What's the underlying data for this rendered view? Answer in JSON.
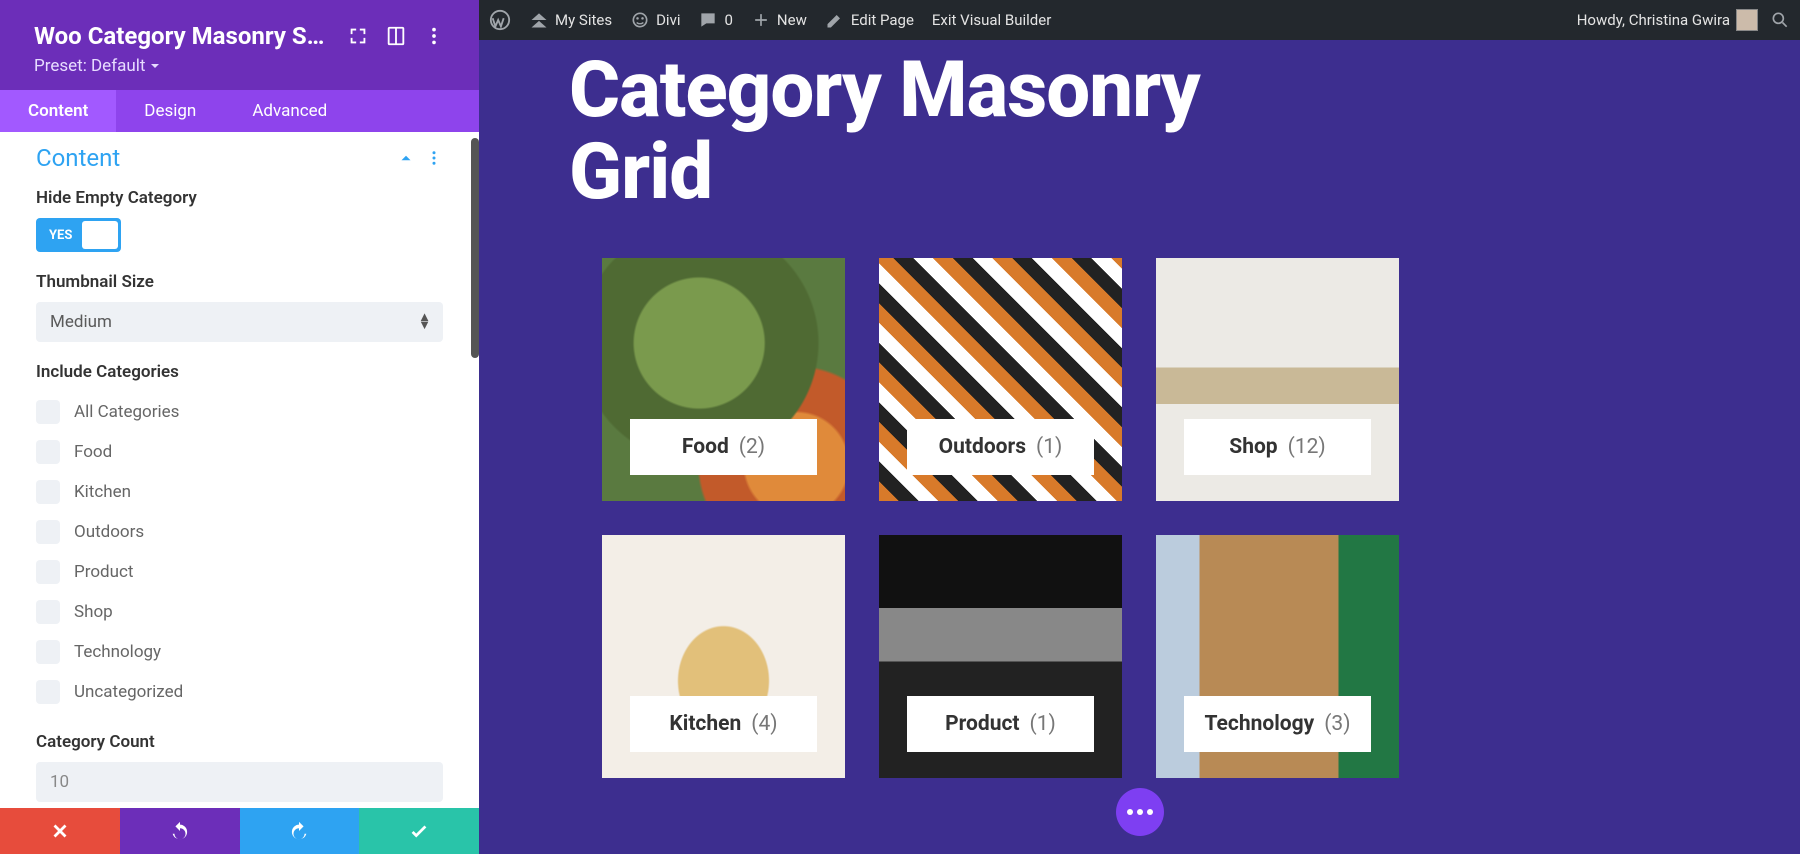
{
  "admin": {
    "mySites": "My Sites",
    "siteName": "Divi",
    "comments": "0",
    "newLabel": "New",
    "editPage": "Edit Page",
    "exitVB": "Exit Visual Builder",
    "greeting": "Howdy, Christina Gwira"
  },
  "panel": {
    "title": "Woo Category Masonry Set...",
    "preset": "Preset: Default",
    "tabs": {
      "content": "Content",
      "design": "Design",
      "advanced": "Advanced"
    },
    "section": "Content",
    "fields": {
      "hideEmpty": {
        "label": "Hide Empty Category",
        "toggle": "YES"
      },
      "thumb": {
        "label": "Thumbnail Size",
        "value": "Medium"
      },
      "include": {
        "label": "Include Categories",
        "items": [
          "All Categories",
          "Food",
          "Kitchen",
          "Outdoors",
          "Product",
          "Shop",
          "Technology",
          "Uncategorized"
        ]
      },
      "count": {
        "label": "Category Count",
        "placeholder": "10"
      }
    }
  },
  "preview": {
    "title1": "Category Masonry",
    "title2": "Grid",
    "cards": [
      {
        "name": "Food",
        "count": "(2)",
        "img": "img1"
      },
      {
        "name": "Outdoors",
        "count": "(1)",
        "img": "img2"
      },
      {
        "name": "Shop",
        "count": "(12)",
        "img": "img3"
      },
      {
        "name": "Kitchen",
        "count": "(4)",
        "img": "img4"
      },
      {
        "name": "Product",
        "count": "(1)",
        "img": "img5"
      },
      {
        "name": "Technology",
        "count": "(3)",
        "img": "img6"
      }
    ]
  }
}
